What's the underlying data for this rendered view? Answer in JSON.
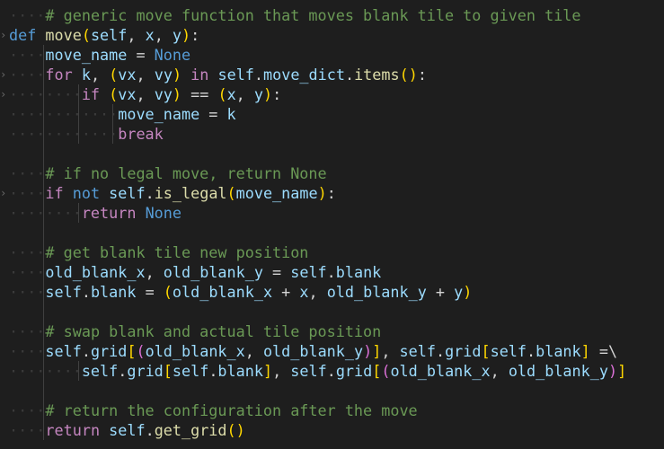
{
  "code": {
    "lines": [
      [
        {
          "t": "····",
          "c": "ws"
        },
        {
          "t": "# generic move function that moves blank tile to given tile",
          "c": "cm"
        }
      ],
      [
        {
          "t": "def",
          "c": "kw"
        },
        {
          "t": " ",
          "c": "txt"
        },
        {
          "t": "move",
          "c": "fn"
        },
        {
          "t": "(",
          "c": "br1"
        },
        {
          "t": "self",
          "c": "var"
        },
        {
          "t": ", ",
          "c": "txt"
        },
        {
          "t": "x",
          "c": "var"
        },
        {
          "t": ", ",
          "c": "txt"
        },
        {
          "t": "y",
          "c": "var"
        },
        {
          "t": ")",
          "c": "br1"
        },
        {
          "t": ":",
          "c": "txt"
        }
      ],
      [
        {
          "t": "····",
          "c": "ws"
        },
        {
          "t": "move_name",
          "c": "var"
        },
        {
          "t": " = ",
          "c": "txt"
        },
        {
          "t": "None",
          "c": "kw"
        }
      ],
      [
        {
          "t": "····",
          "c": "ws"
        },
        {
          "t": "for",
          "c": "ctl"
        },
        {
          "t": " ",
          "c": "txt"
        },
        {
          "t": "k",
          "c": "var"
        },
        {
          "t": ", ",
          "c": "txt"
        },
        {
          "t": "(",
          "c": "br1"
        },
        {
          "t": "vx",
          "c": "var"
        },
        {
          "t": ", ",
          "c": "txt"
        },
        {
          "t": "vy",
          "c": "var"
        },
        {
          "t": ")",
          "c": "br1"
        },
        {
          "t": " ",
          "c": "txt"
        },
        {
          "t": "in",
          "c": "ctl"
        },
        {
          "t": " ",
          "c": "txt"
        },
        {
          "t": "self",
          "c": "var"
        },
        {
          "t": ".",
          "c": "txt"
        },
        {
          "t": "move_dict",
          "c": "var"
        },
        {
          "t": ".",
          "c": "txt"
        },
        {
          "t": "items",
          "c": "fn"
        },
        {
          "t": "(",
          "c": "br1"
        },
        {
          "t": ")",
          "c": "br1"
        },
        {
          "t": ":",
          "c": "txt"
        }
      ],
      [
        {
          "t": "········",
          "c": "ws"
        },
        {
          "t": "if",
          "c": "ctl"
        },
        {
          "t": " ",
          "c": "txt"
        },
        {
          "t": "(",
          "c": "br1"
        },
        {
          "t": "vx",
          "c": "var"
        },
        {
          "t": ", ",
          "c": "txt"
        },
        {
          "t": "vy",
          "c": "var"
        },
        {
          "t": ")",
          "c": "br1"
        },
        {
          "t": " == ",
          "c": "txt"
        },
        {
          "t": "(",
          "c": "br1"
        },
        {
          "t": "x",
          "c": "var"
        },
        {
          "t": ", ",
          "c": "txt"
        },
        {
          "t": "y",
          "c": "var"
        },
        {
          "t": ")",
          "c": "br1"
        },
        {
          "t": ":",
          "c": "txt"
        }
      ],
      [
        {
          "t": "············",
          "c": "ws"
        },
        {
          "t": "move_name",
          "c": "var"
        },
        {
          "t": " = ",
          "c": "txt"
        },
        {
          "t": "k",
          "c": "var"
        }
      ],
      [
        {
          "t": "············",
          "c": "ws"
        },
        {
          "t": "break",
          "c": "ctl"
        }
      ],
      [],
      [
        {
          "t": "····",
          "c": "ws"
        },
        {
          "t": "# if no legal move, return None",
          "c": "cm"
        }
      ],
      [
        {
          "t": "····",
          "c": "ws"
        },
        {
          "t": "if",
          "c": "ctl"
        },
        {
          "t": " ",
          "c": "txt"
        },
        {
          "t": "not",
          "c": "kw"
        },
        {
          "t": " ",
          "c": "txt"
        },
        {
          "t": "self",
          "c": "var"
        },
        {
          "t": ".",
          "c": "txt"
        },
        {
          "t": "is_legal",
          "c": "fn"
        },
        {
          "t": "(",
          "c": "br1"
        },
        {
          "t": "move_name",
          "c": "var"
        },
        {
          "t": ")",
          "c": "br1"
        },
        {
          "t": ":",
          "c": "txt"
        }
      ],
      [
        {
          "t": "········",
          "c": "ws"
        },
        {
          "t": "return",
          "c": "ctl"
        },
        {
          "t": " ",
          "c": "txt"
        },
        {
          "t": "None",
          "c": "kw"
        }
      ],
      [],
      [
        {
          "t": "····",
          "c": "ws"
        },
        {
          "t": "# get blank tile new position",
          "c": "cm"
        }
      ],
      [
        {
          "t": "····",
          "c": "ws"
        },
        {
          "t": "old_blank_x",
          "c": "var"
        },
        {
          "t": ", ",
          "c": "txt"
        },
        {
          "t": "old_blank_y",
          "c": "var"
        },
        {
          "t": " = ",
          "c": "txt"
        },
        {
          "t": "self",
          "c": "var"
        },
        {
          "t": ".",
          "c": "txt"
        },
        {
          "t": "blank",
          "c": "var"
        }
      ],
      [
        {
          "t": "····",
          "c": "ws"
        },
        {
          "t": "self",
          "c": "var"
        },
        {
          "t": ".",
          "c": "txt"
        },
        {
          "t": "blank",
          "c": "var"
        },
        {
          "t": " = ",
          "c": "txt"
        },
        {
          "t": "(",
          "c": "br1"
        },
        {
          "t": "old_blank_x",
          "c": "var"
        },
        {
          "t": " + ",
          "c": "txt"
        },
        {
          "t": "x",
          "c": "var"
        },
        {
          "t": ", ",
          "c": "txt"
        },
        {
          "t": "old_blank_y",
          "c": "var"
        },
        {
          "t": " + ",
          "c": "txt"
        },
        {
          "t": "y",
          "c": "var"
        },
        {
          "t": ")",
          "c": "br1"
        }
      ],
      [],
      [
        {
          "t": "····",
          "c": "ws"
        },
        {
          "t": "# swap blank and actual tile position",
          "c": "cm"
        }
      ],
      [
        {
          "t": "····",
          "c": "ws"
        },
        {
          "t": "self",
          "c": "var"
        },
        {
          "t": ".",
          "c": "txt"
        },
        {
          "t": "grid",
          "c": "var"
        },
        {
          "t": "[",
          "c": "br1"
        },
        {
          "t": "(",
          "c": "br2"
        },
        {
          "t": "old_blank_x",
          "c": "var"
        },
        {
          "t": ", ",
          "c": "txt"
        },
        {
          "t": "old_blank_y",
          "c": "var"
        },
        {
          "t": ")",
          "c": "br2"
        },
        {
          "t": "]",
          "c": "br1"
        },
        {
          "t": ", ",
          "c": "txt"
        },
        {
          "t": "self",
          "c": "var"
        },
        {
          "t": ".",
          "c": "txt"
        },
        {
          "t": "grid",
          "c": "var"
        },
        {
          "t": "[",
          "c": "br1"
        },
        {
          "t": "self",
          "c": "var"
        },
        {
          "t": ".",
          "c": "txt"
        },
        {
          "t": "blank",
          "c": "var"
        },
        {
          "t": "]",
          "c": "br1"
        },
        {
          "t": " =\\",
          "c": "txt"
        }
      ],
      [
        {
          "t": "········",
          "c": "ws"
        },
        {
          "t": "self",
          "c": "var"
        },
        {
          "t": ".",
          "c": "txt"
        },
        {
          "t": "grid",
          "c": "var"
        },
        {
          "t": "[",
          "c": "br1"
        },
        {
          "t": "self",
          "c": "var"
        },
        {
          "t": ".",
          "c": "txt"
        },
        {
          "t": "blank",
          "c": "var"
        },
        {
          "t": "]",
          "c": "br1"
        },
        {
          "t": ", ",
          "c": "txt"
        },
        {
          "t": "self",
          "c": "var"
        },
        {
          "t": ".",
          "c": "txt"
        },
        {
          "t": "grid",
          "c": "var"
        },
        {
          "t": "[",
          "c": "br1"
        },
        {
          "t": "(",
          "c": "br2"
        },
        {
          "t": "old_blank_x",
          "c": "var"
        },
        {
          "t": ", ",
          "c": "txt"
        },
        {
          "t": "old_blank_y",
          "c": "var"
        },
        {
          "t": ")",
          "c": "br2"
        },
        {
          "t": "]",
          "c": "br1"
        }
      ],
      [],
      [
        {
          "t": "····",
          "c": "ws"
        },
        {
          "t": "# return the configuration after the move",
          "c": "cm"
        }
      ],
      [
        {
          "t": "····",
          "c": "ws"
        },
        {
          "t": "return",
          "c": "ctl"
        },
        {
          "t": " ",
          "c": "txt"
        },
        {
          "t": "self",
          "c": "var"
        },
        {
          "t": ".",
          "c": "txt"
        },
        {
          "t": "get_grid",
          "c": "fn"
        },
        {
          "t": "(",
          "c": "br1"
        },
        {
          "t": ")",
          "c": "br1"
        }
      ]
    ],
    "fold_markers": [
      "",
      "›",
      "",
      "›",
      "›",
      "",
      "",
      "",
      "",
      "›",
      "",
      "",
      "",
      "",
      "",
      "",
      "",
      "",
      "",
      "",
      "",
      ""
    ]
  },
  "colors": {
    "background": "#1e1e1e",
    "comment": "#6a9955",
    "keyword": "#569cd6",
    "control": "#c586c0",
    "function": "#dcdcaa",
    "variable": "#9cdcfe",
    "bracket_1": "#ffd700",
    "bracket_2": "#da70d6"
  }
}
